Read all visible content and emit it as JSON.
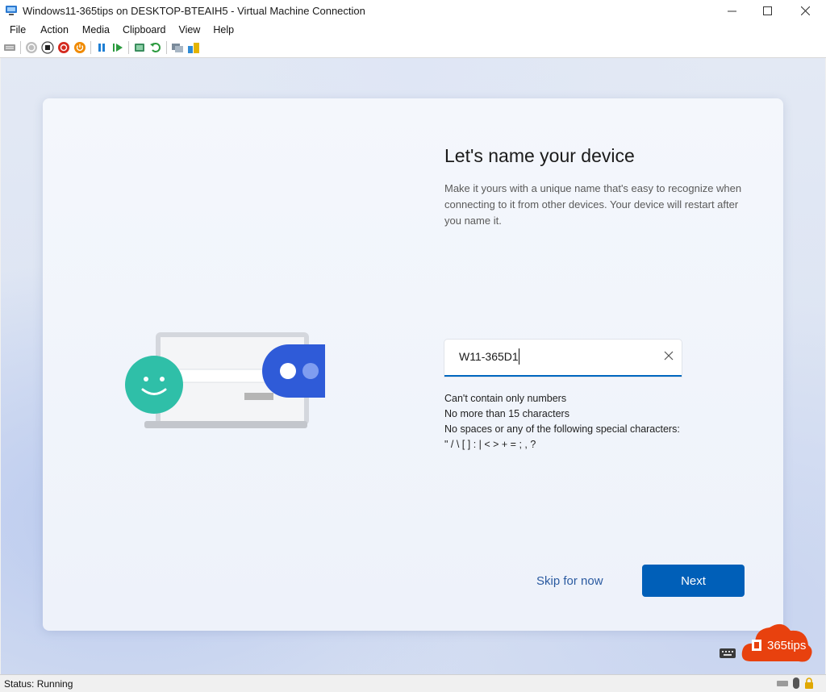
{
  "window": {
    "title": "Windows11-365tips on DESKTOP-BTEAIH5 - Virtual Machine Connection"
  },
  "menu": [
    "File",
    "Action",
    "Media",
    "Clipboard",
    "View",
    "Help"
  ],
  "setup": {
    "heading": "Let's name your device",
    "description": "Make it yours with a unique name that's easy to recognize when connecting to it from other devices. Your device will restart after you name it.",
    "device_name_value": "W11-365D1",
    "rules": [
      "Can't contain only numbers",
      "No more than 15 characters",
      "No spaces or any of the following special characters:",
      "\" / \\ [ ] : | < > + = ; , ?"
    ],
    "skip_label": "Skip for now",
    "next_label": "Next"
  },
  "brand": {
    "text": "365tips"
  },
  "statusbar": {
    "status": "Status: Running"
  },
  "colors": {
    "accent": "#005fb8",
    "brand": "#e8410e"
  }
}
